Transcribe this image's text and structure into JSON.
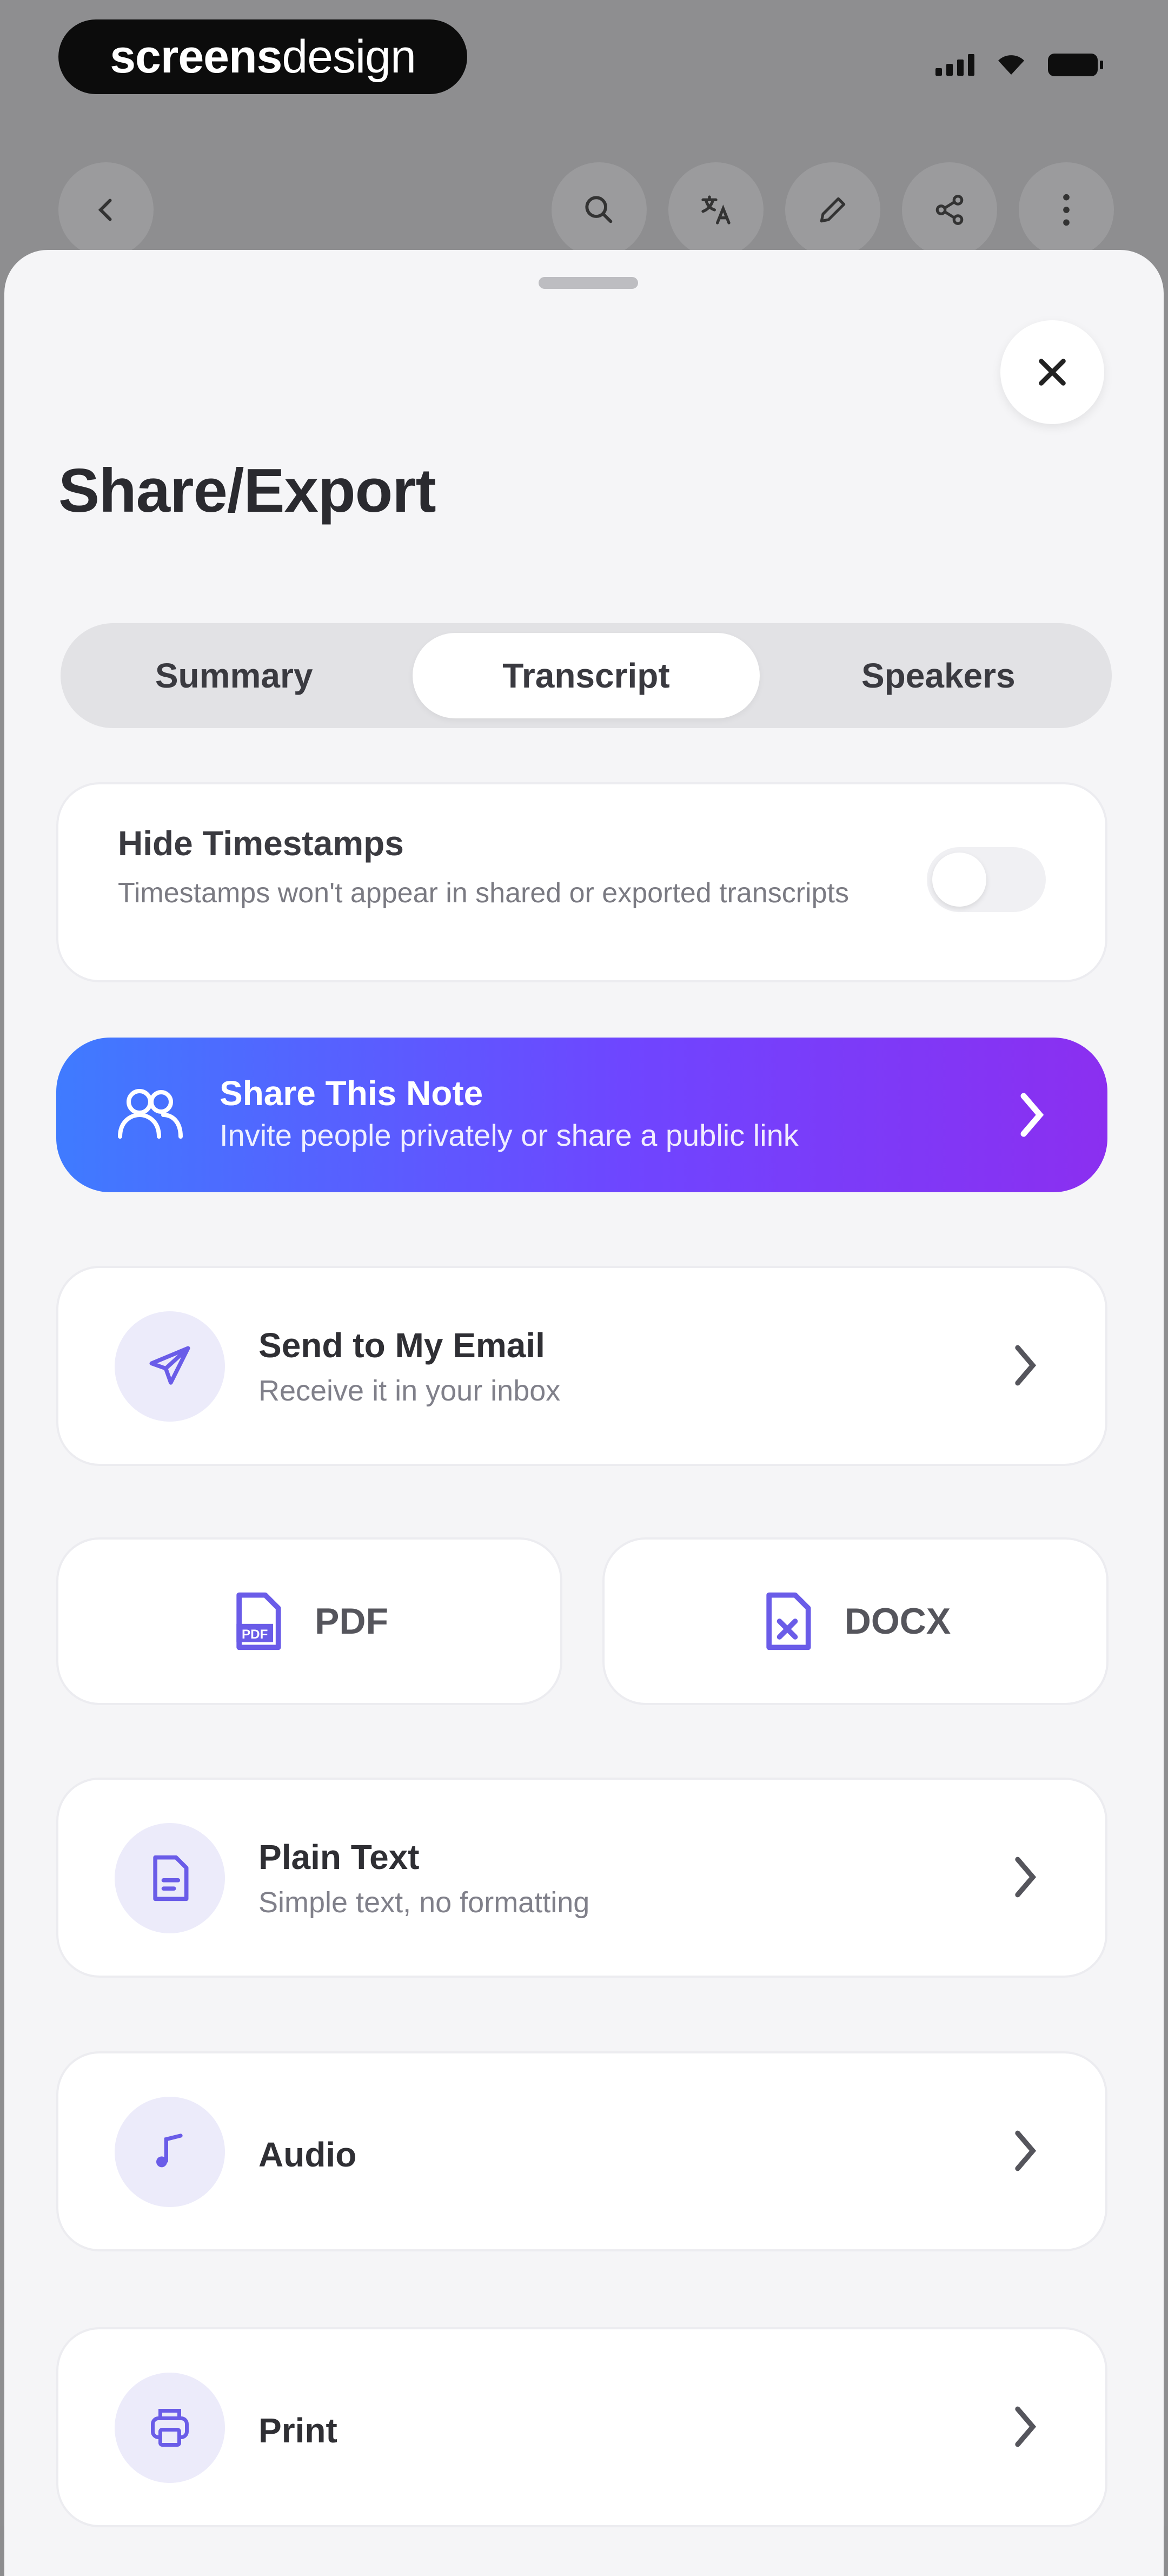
{
  "status_bar": {
    "brand_bold": "screens",
    "brand_light": "design"
  },
  "toolbar": {
    "back_icon": "chevron-left-icon",
    "icons": [
      "search-icon",
      "translate-icon",
      "edit-icon",
      "share-icon",
      "more-icon"
    ]
  },
  "sheet": {
    "title": "Share/Export",
    "close_icon": "close-icon",
    "tabs": [
      {
        "label": "Summary",
        "active": false
      },
      {
        "label": "Transcript",
        "active": true
      },
      {
        "label": "Speakers",
        "active": false
      }
    ],
    "timestamps": {
      "title": "Hide Timestamps",
      "subtitle": "Timestamps won't appear in shared or exported transcripts",
      "enabled": false
    },
    "share_note": {
      "title": "Share This Note",
      "subtitle": "Invite people privately or share a public link",
      "gradient_start": "#3f7bff",
      "gradient_end": "#8b2ff0"
    },
    "email": {
      "title": "Send to My Email",
      "subtitle": "Receive it in your inbox"
    },
    "pdf_label": "PDF",
    "docx_label": "DOCX",
    "plain_text": {
      "title": "Plain Text",
      "subtitle": "Simple text, no formatting"
    },
    "audio": {
      "title": "Audio"
    },
    "print": {
      "title": "Print"
    },
    "accent_color": "#6a5ce8"
  }
}
